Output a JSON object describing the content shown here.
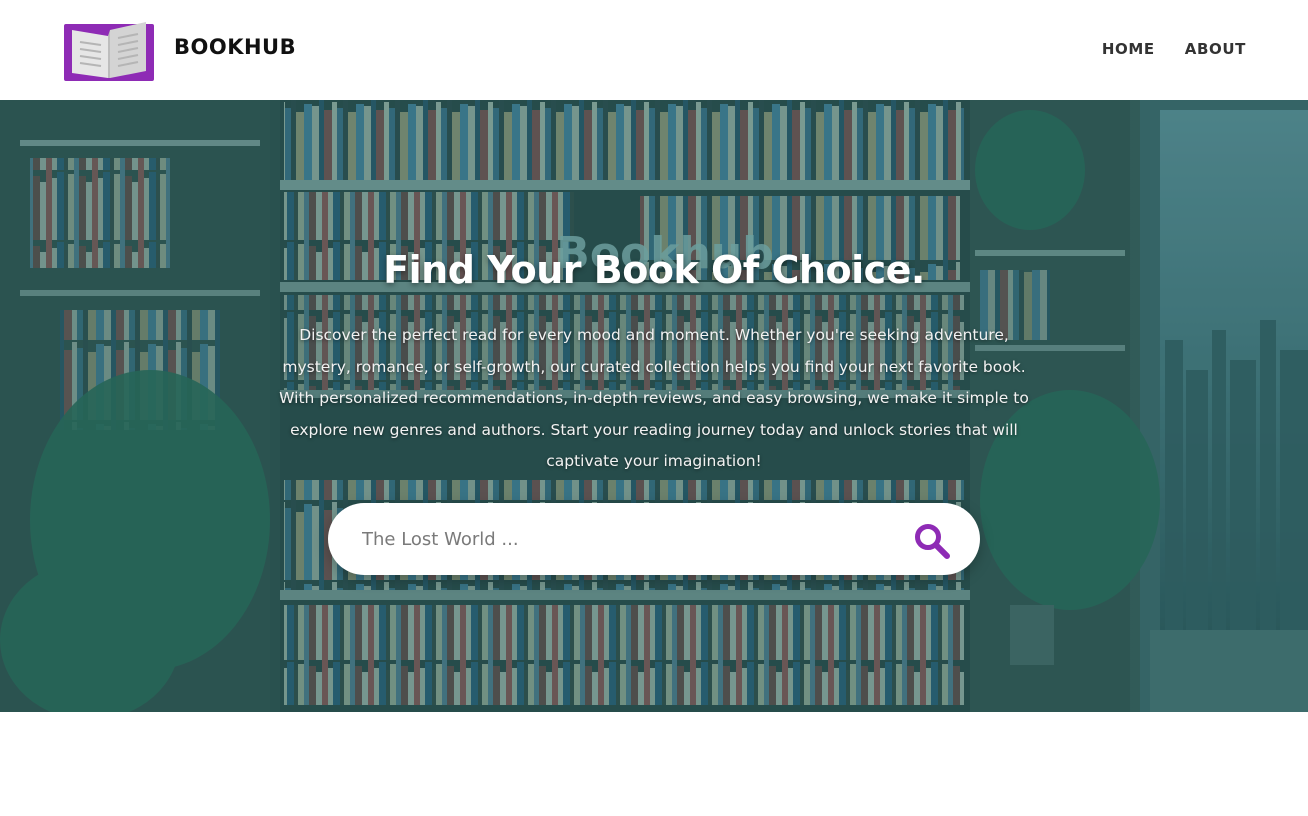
{
  "header": {
    "logo_icon": "open-book-icon",
    "brand": "BOOKHUB",
    "nav": [
      {
        "label": "HOME"
      },
      {
        "label": "ABOUT"
      }
    ]
  },
  "hero": {
    "background_image_text": "Bookhub",
    "title": "Find Your Book Of Choice.",
    "description": "Discover the perfect read for every mood and moment. Whether you're seeking adventure, mystery, romance, or self-growth, our curated collection helps you find your next favorite book. With personalized recommendations, in-depth reviews, and easy browsing, we make it simple to explore new genres and authors. Start your reading journey today and unlock stories that will captivate your imagination!",
    "search": {
      "placeholder": "The Lost World ...",
      "value": "",
      "icon": "search-icon"
    }
  },
  "colors": {
    "accent": "#8e2bb5",
    "overlay": "#2a7c78"
  }
}
